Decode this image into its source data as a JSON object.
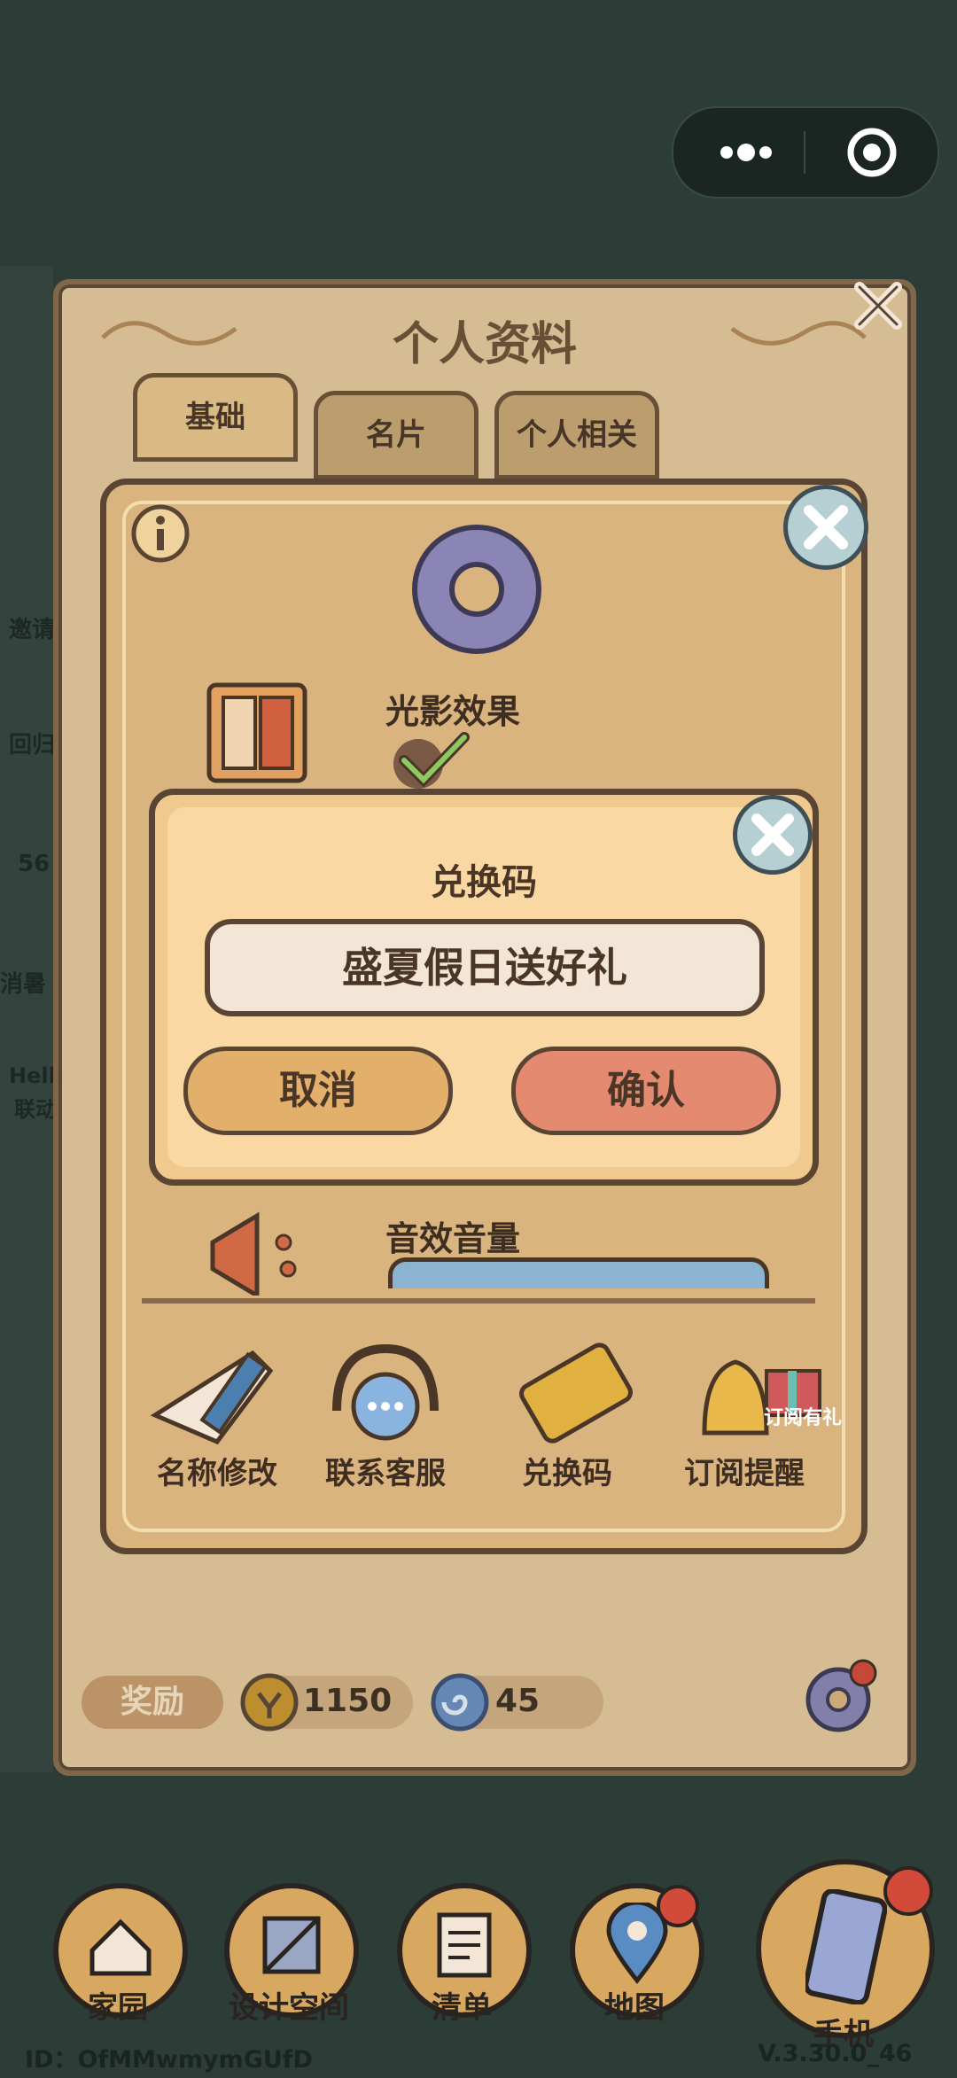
{
  "capsule": {
    "more_icon": "more-dots-icon",
    "close_icon": "target-close-icon"
  },
  "profile": {
    "title": "个人资料",
    "tabs": [
      {
        "label": "基础"
      },
      {
        "label": "名片"
      },
      {
        "label": "个人相关"
      }
    ],
    "reward_label": "奖励",
    "coins": "1150",
    "gems": "45"
  },
  "settings": {
    "light_effect_label": "光影效果",
    "sound_volume_label": "音效音量",
    "tools": [
      {
        "label": "名称修改"
      },
      {
        "label": "联系客服"
      },
      {
        "label": "兑换码"
      },
      {
        "label": "订阅提醒"
      }
    ],
    "subscribe_badge": "订阅有礼"
  },
  "dialog": {
    "title": "兑换码",
    "code_value": "盛夏假日送好礼",
    "cancel_label": "取消",
    "confirm_label": "确认"
  },
  "nav": {
    "items": [
      {
        "label": "家园"
      },
      {
        "label": "设计空间"
      },
      {
        "label": "清单"
      },
      {
        "label": "地图"
      },
      {
        "label": "手机"
      }
    ]
  },
  "footer": {
    "user_id": "ID：OfMMwmymGUfD",
    "version": "V.3.30.0_46"
  },
  "side": {
    "labels": [
      "邀请",
      "回归",
      "56",
      "消暑",
      "Hello",
      "联动"
    ]
  }
}
